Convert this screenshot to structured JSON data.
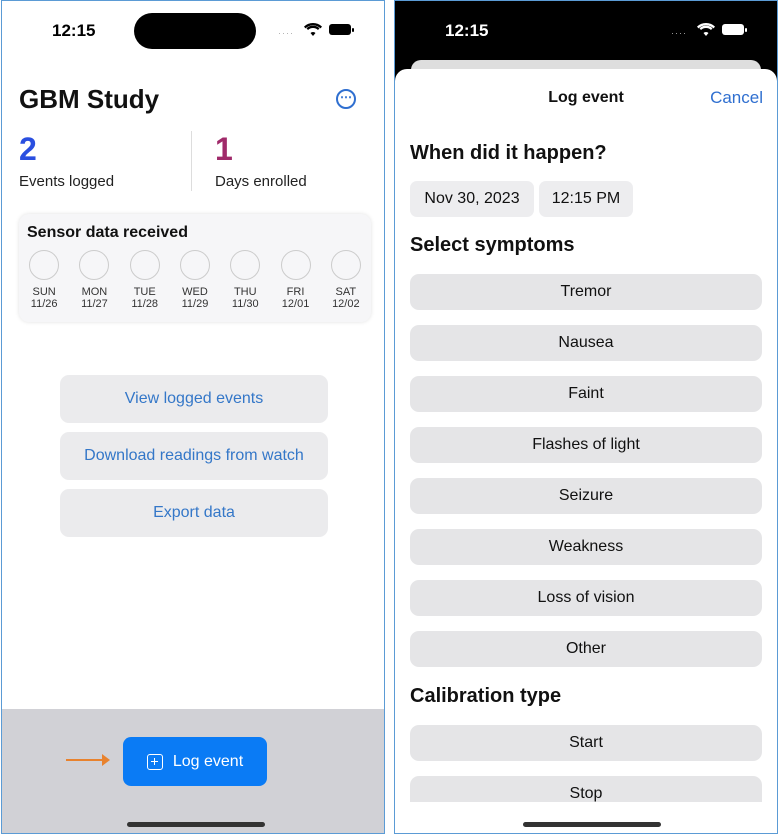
{
  "left": {
    "status": {
      "time": "12:15"
    },
    "title": "GBM Study",
    "more_icon": "⋯",
    "stats": [
      {
        "value": "2",
        "label": "Events logged",
        "color": "#2a4fe0"
      },
      {
        "value": "1",
        "label": "Days enrolled",
        "color": "#a02a6a"
      }
    ],
    "sensor": {
      "title": "Sensor data received",
      "days": [
        {
          "name": "SUN",
          "date": "11/26"
        },
        {
          "name": "MON",
          "date": "11/27"
        },
        {
          "name": "TUE",
          "date": "11/28"
        },
        {
          "name": "WED",
          "date": "11/29"
        },
        {
          "name": "THU",
          "date": "11/30"
        },
        {
          "name": "FRI",
          "date": "12/01"
        },
        {
          "name": "SAT",
          "date": "12/02"
        }
      ]
    },
    "buttons": [
      "View logged events",
      "Download readings from watch",
      "Export data"
    ],
    "log_event": "Log event"
  },
  "right": {
    "status": {
      "time": "12:15"
    },
    "sheet_title": "Log event",
    "cancel": "Cancel",
    "when_heading": "When did it happen?",
    "date": "Nov 30, 2023",
    "time": "12:15 PM",
    "symptoms_heading": "Select symptoms",
    "symptoms": [
      "Tremor",
      "Nausea",
      "Faint",
      "Flashes of light",
      "Seizure",
      "Weakness",
      "Loss of vision",
      "Other"
    ],
    "calibration_heading": "Calibration type",
    "calibration": [
      "Start",
      "Stop"
    ]
  }
}
